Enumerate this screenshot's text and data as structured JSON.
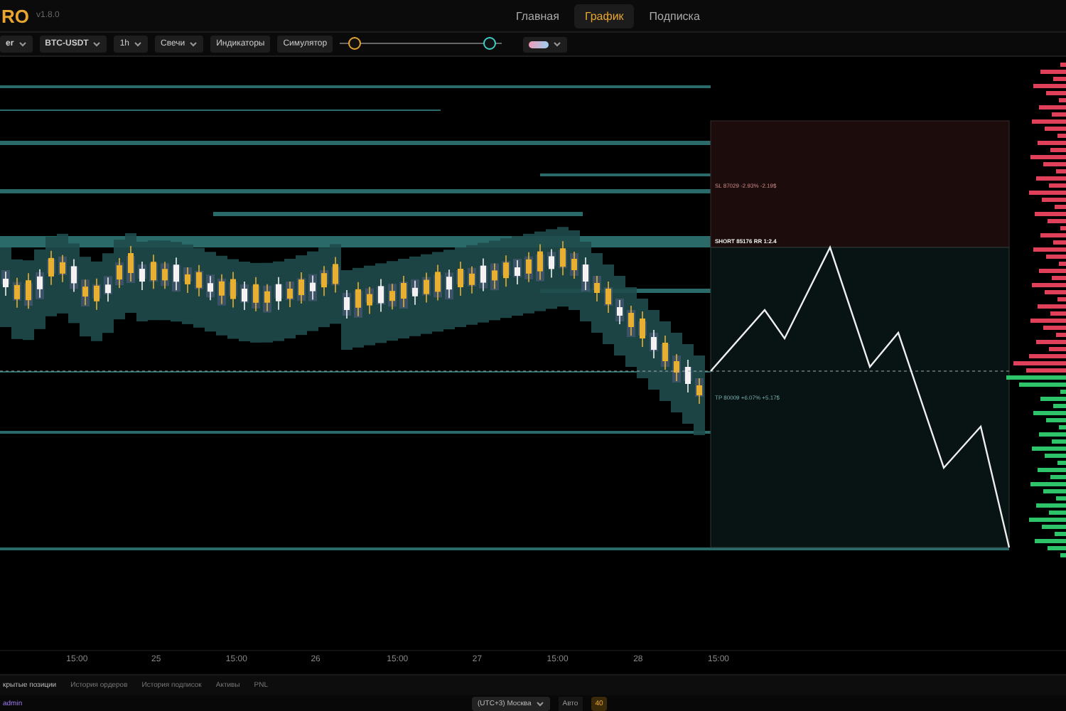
{
  "app": {
    "logo": "RO",
    "version": "v1.8.0"
  },
  "nav": [
    {
      "label": "Главная",
      "selected": false
    },
    {
      "label": "График",
      "selected": true
    },
    {
      "label": "Подписка",
      "selected": false
    }
  ],
  "toolbar": {
    "exchange": "er",
    "symbol": "BTC-USDT",
    "timeframe": "1h",
    "chart_type": "Свечи",
    "buttons": [
      "Индикаторы",
      "Симулятор"
    ],
    "slider": {
      "low": {
        "level": 0.1
      },
      "high": {
        "level": 0.93
      }
    }
  },
  "trade": {
    "sl_label": "SL 87029 -2.93% -2.19$",
    "entry_label": "SHORT 85176 RR 1:2.4",
    "tp_label": "TP 80009 +6.07% +5.17$"
  },
  "x_axis": {
    "labels": [
      "15:00",
      "25",
      "15:00",
      "26",
      "15:00",
      "27",
      "15:00",
      "28",
      "15:00"
    ]
  },
  "bottom_tabs": [
    {
      "label": "крытые позиции",
      "selected": true
    },
    {
      "label": "История ордеров",
      "selected": false
    },
    {
      "label": "История подписок",
      "selected": false
    },
    {
      "label": "Активы",
      "selected": false
    },
    {
      "label": "PNL",
      "selected": false
    }
  ],
  "status_bar": {
    "user": "admin",
    "timezone": "(UTC+3) Москва",
    "auto_label": "Авто",
    "auto_value": "40"
  }
}
